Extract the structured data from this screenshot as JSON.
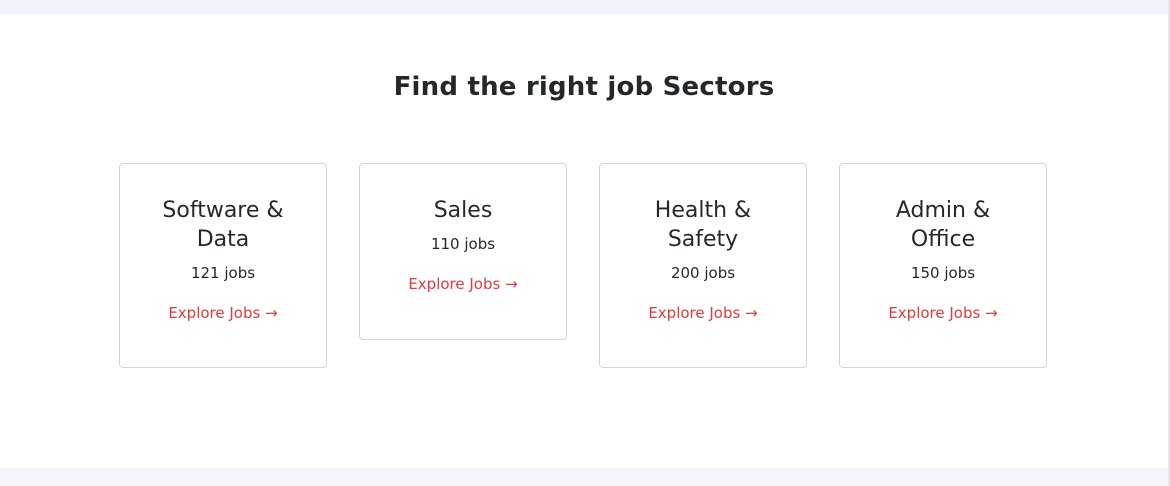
{
  "section": {
    "title": "Find the right job Sectors"
  },
  "sectors": [
    {
      "name": "Software & Data",
      "count": "121 jobs",
      "link": "Explore Jobs →"
    },
    {
      "name": "Sales",
      "count": "110 jobs",
      "link": "Explore Jobs →"
    },
    {
      "name": "Health & Safety",
      "count": "200 jobs",
      "link": "Explore Jobs →"
    },
    {
      "name": "Admin & Office",
      "count": "150 jobs",
      "link": "Explore Jobs →"
    }
  ],
  "colors": {
    "link": "#e0393e",
    "text": "#25282b",
    "border": "#d3d5d8",
    "page_band": "#f3f5fb"
  }
}
